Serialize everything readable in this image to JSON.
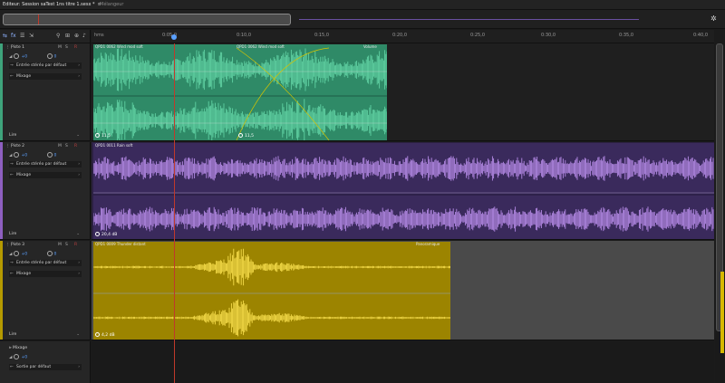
{
  "tabs": {
    "editor": "Editeur: Session saTest 1ns titre 1.sesx *",
    "editor_close": "≡",
    "mixer": "Mélangeur"
  },
  "ruler": {
    "unit": "hms",
    "ticks": [
      "0:05,0",
      "0:10,0",
      "0:15,0",
      "0:20,0",
      "0:25,0",
      "0:30,0",
      "0:35,0",
      "0:40,0"
    ]
  },
  "tracks": [
    {
      "name": "Piste 1",
      "mute": "M",
      "solo": "S",
      "arm": "R",
      "volume": "+0",
      "pan": "0",
      "input": "Entrée stéréo par défaut",
      "output": "Mixage",
      "automation": "Lire",
      "color": "#3ea37b",
      "clips": [
        {
          "title": "QPD1 0062 Wind mod soft",
          "db": "11,5"
        },
        {
          "title": "QPD1 0062 Wind mod soft",
          "db": "11,5",
          "extra": "Volume"
        }
      ]
    },
    {
      "name": "Piste 2",
      "mute": "M",
      "solo": "S",
      "arm": "R",
      "volume": "+0",
      "pan": "0",
      "input": "Entrée stéréo par défaut",
      "output": "Mixage",
      "automation": "Lire",
      "color": "#8e5fc0",
      "clips": [
        {
          "title": "QPD1 0011 Rain soft",
          "db": "20,4 dB"
        }
      ]
    },
    {
      "name": "Piste 3",
      "mute": "M",
      "solo": "S",
      "arm": "R",
      "volume": "+0",
      "pan": "0",
      "input": "Entrée stéréo par défaut",
      "output": "Mixage",
      "automation": "Lire",
      "color": "#b59a00",
      "clips": [
        {
          "title": "QPD1 0009 Thunder distant",
          "db": "4,2 dB",
          "extra": "Panoramique"
        }
      ]
    }
  ],
  "master": {
    "name": "Mixage",
    "volume": "+0",
    "output": "Sortie par défaut"
  },
  "colors": {
    "wind": "#3ea37b",
    "rain": "#8e5fc0",
    "thunder": "#b59a00",
    "playhead": "#c0392b"
  }
}
